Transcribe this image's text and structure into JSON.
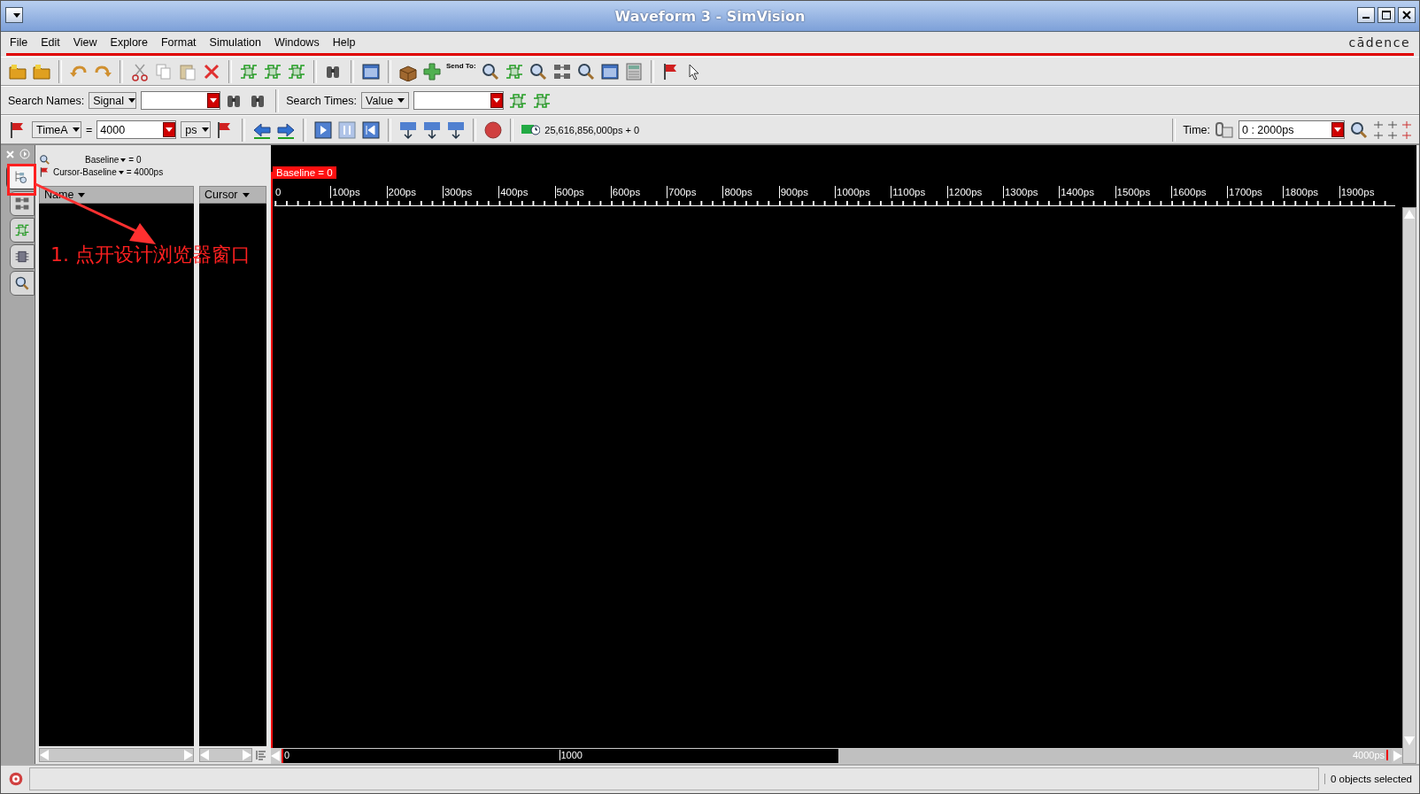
{
  "window": {
    "title": "Waveform 3 - SimVision"
  },
  "menu": [
    "File",
    "Edit",
    "View",
    "Explore",
    "Format",
    "Simulation",
    "Windows",
    "Help"
  ],
  "logo": "cādence",
  "toolbar": {
    "send_to_label": "Send To:"
  },
  "search_bar": {
    "names_label": "Search Names:",
    "names_scope": "Signal",
    "times_label": "Search Times:",
    "times_scope": "Value"
  },
  "time_bar": {
    "cursor": "TimeA",
    "equals": "=",
    "cursor_time": "4000",
    "unit": "ps",
    "sim_time": "25,616,856,000ps + 0",
    "range_label": "Time:",
    "range": "0 : 2000ps"
  },
  "sidebar": {
    "tabs": [
      {
        "selected": true
      },
      {
        "selected": false
      },
      {
        "selected": false
      },
      {
        "selected": false
      },
      {
        "selected": false
      }
    ]
  },
  "cursor_info": [
    {
      "label": "Baseline",
      "value": "= 0"
    },
    {
      "label": "Cursor-Baseline",
      "value": "= 4000ps"
    }
  ],
  "columns": [
    "Name",
    "Cursor"
  ],
  "waveform": {
    "baseline_tag": "Baseline = 0",
    "ruler": [
      "0",
      "100ps",
      "200ps",
      "300ps",
      "400ps",
      "500ps",
      "600ps",
      "700ps",
      "800ps",
      "900ps",
      "1000ps",
      "1100ps",
      "1200ps",
      "1300ps",
      "1400ps",
      "1500ps",
      "1600ps",
      "1700ps",
      "1800ps",
      "1900ps"
    ]
  },
  "overview": {
    "start": "0",
    "mark": "1000",
    "end": "4000ps",
    "level": 0.5
  },
  "status_bar": {
    "selection": "0 objects selected"
  },
  "annotation": {
    "text": "1. 点开设计浏览器窗口"
  }
}
